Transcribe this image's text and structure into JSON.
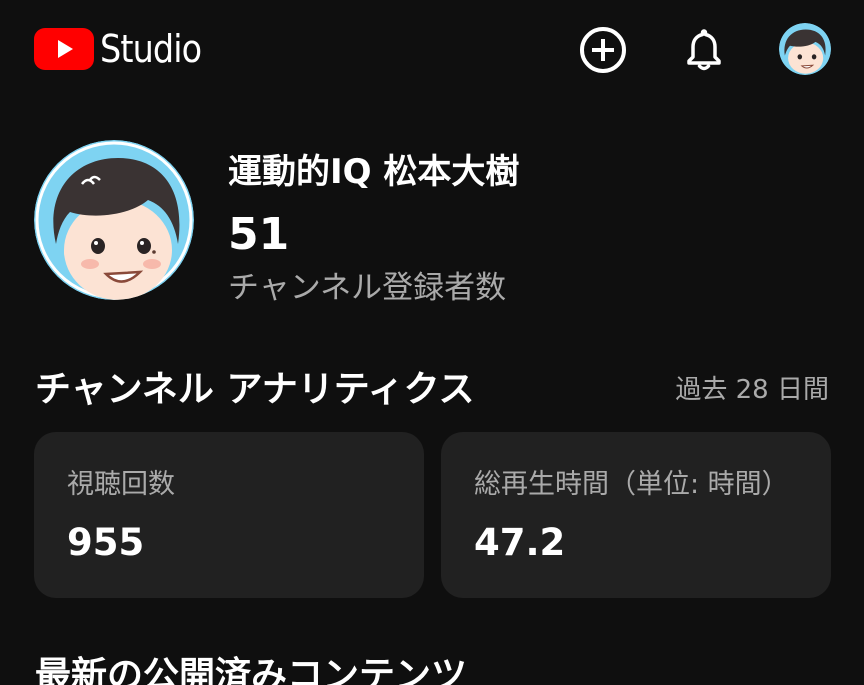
{
  "header": {
    "logo_text": "Studio",
    "icons": [
      "create-icon",
      "notifications-bell-icon",
      "account-avatar"
    ]
  },
  "channel": {
    "name": "運動的IQ 松本大樹",
    "subscribers": "51",
    "subscribers_label": "チャンネル登録者数"
  },
  "analytics": {
    "title": "チャンネル アナリティクス",
    "period": "過去 28 日間",
    "cards": [
      {
        "label": "視聴回数",
        "value": "955"
      },
      {
        "label": "総再生時間（単位: 時間）",
        "value": "47.2"
      }
    ]
  },
  "latest": {
    "title": "最新の公開済みコンテンツ"
  },
  "colors": {
    "background": "#0f0f0f",
    "card": "#212121",
    "brand_red": "#ff0000",
    "secondary_text": "#aaaaaa",
    "avatar_bg": "#7ed3f2"
  }
}
